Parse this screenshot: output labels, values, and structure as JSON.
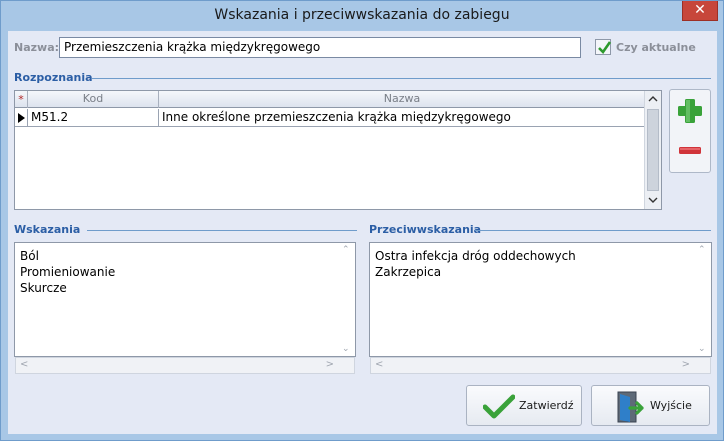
{
  "window": {
    "title": "Wskazania i przeciwwskazania do zabiegu",
    "close_glyph": "✕"
  },
  "name_field": {
    "label": "Nazwa:",
    "value": "Przemieszczenia krążka międzykręgowego"
  },
  "current_checkbox": {
    "label": "Czy aktualne",
    "checked": true
  },
  "diagnoses": {
    "group_title": "Rozpoznania",
    "star": "*",
    "columns": [
      "Kod",
      "Nazwa"
    ],
    "rows": [
      {
        "code": "M51.2",
        "name": "Inne określone przemieszczenia krążka międzykręgowego"
      }
    ],
    "add_icon": "plus-icon",
    "remove_icon": "minus-icon"
  },
  "indications": {
    "group_title": "Wskazania",
    "text": "Ból\nPromieniowanie\nSkurcze"
  },
  "contraindications": {
    "group_title": "Przeciwwskazania",
    "text": "Ostra infekcja dróg oddechowych\nZakrzepica"
  },
  "buttons": {
    "confirm_label": "Zatwierdź",
    "exit_label": "Wyjście"
  },
  "colors": {
    "title_bar": "#a8c7e6",
    "close_button": "#c7463a",
    "group_title": "#2b5ea5",
    "client_bg": "#e4e9f5",
    "check_green": "#2e9a2e"
  }
}
